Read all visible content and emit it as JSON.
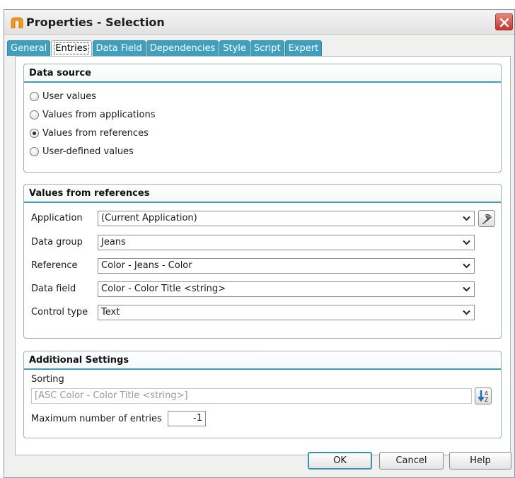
{
  "window": {
    "title": "Properties - Selection"
  },
  "tabs": [
    {
      "label": "General",
      "active": false
    },
    {
      "label": "Entries",
      "active": true
    },
    {
      "label": "Data Field",
      "active": false
    },
    {
      "label": "Dependencies",
      "active": false
    },
    {
      "label": "Style",
      "active": false
    },
    {
      "label": "Script",
      "active": false
    },
    {
      "label": "Expert",
      "active": false
    }
  ],
  "data_source": {
    "title": "Data source",
    "options": [
      {
        "label": "User values",
        "checked": false
      },
      {
        "label": "Values from applications",
        "checked": false
      },
      {
        "label": "Values from references",
        "checked": true
      },
      {
        "label": "User-defined values",
        "checked": false
      }
    ]
  },
  "references": {
    "title": "Values from references",
    "fields": [
      {
        "label": "Application",
        "value": "(Current Application)"
      },
      {
        "label": "Data group",
        "value": "Jeans"
      },
      {
        "label": "Reference",
        "value": "Color - Jeans - Color"
      },
      {
        "label": "Data field",
        "value": "Color - Color Title <string>"
      },
      {
        "label": "Control type",
        "value": "Text"
      }
    ]
  },
  "additional": {
    "title": "Additional Settings",
    "sorting_label": "Sorting",
    "sorting_value": "[ASC Color - Color Title <string>]",
    "max_entries_label": "Maximum number of entries",
    "max_entries_value": "-1"
  },
  "buttons": {
    "ok": "OK",
    "cancel": "Cancel",
    "help": "Help"
  },
  "colors": {
    "tab_accent": "#3e9fbf",
    "close_red": "#c0392b",
    "app_icon": "#f39c12"
  },
  "icons": {
    "app": "app-icon",
    "close": "close-icon",
    "dropdown": "chevron-down-icon",
    "picker": "wrench-icon",
    "sort": "sort-az-icon"
  }
}
